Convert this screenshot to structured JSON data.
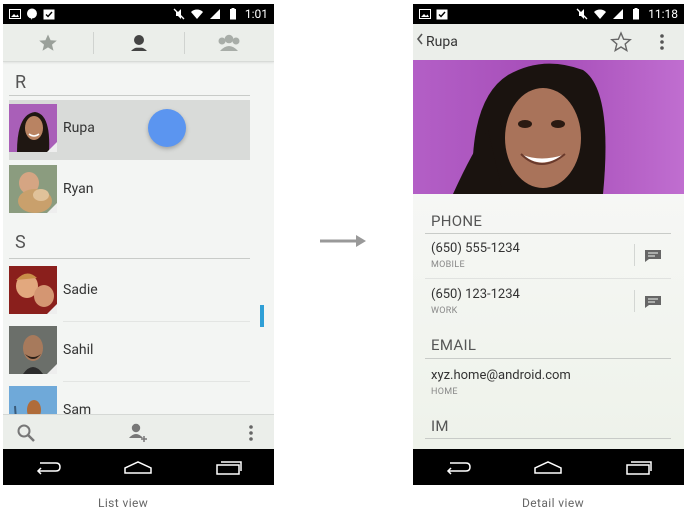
{
  "left_phone": {
    "status_time": "1:01",
    "tabs": [
      {
        "icon": "star-icon"
      },
      {
        "icon": "person-icon"
      },
      {
        "icon": "group-icon"
      }
    ],
    "sections": [
      {
        "letter": "R",
        "contacts": [
          {
            "name": "Rupa",
            "selected": true
          },
          {
            "name": "Ryan"
          }
        ]
      },
      {
        "letter": "S",
        "contacts": [
          {
            "name": "Sadie"
          },
          {
            "name": "Sahil"
          },
          {
            "name": "Sam"
          }
        ]
      }
    ],
    "bottom_actions": [
      "search-icon",
      "add-contact-icon",
      "overflow-menu-icon"
    ]
  },
  "right_phone": {
    "status_time": "11:18",
    "title": "Rupa",
    "sections": {
      "phone": {
        "label": "PHONE",
        "items": [
          {
            "value": "(650) 555-1234",
            "type": "MOBILE"
          },
          {
            "value": "(650) 123-1234",
            "type": "WORK"
          }
        ]
      },
      "email": {
        "label": "EMAIL",
        "items": [
          {
            "value": "xyz.home@android.com",
            "type": "HOME"
          }
        ]
      },
      "im": {
        "label": "IM"
      }
    }
  },
  "captions": {
    "left": "List view",
    "right": "Detail view"
  },
  "colors": {
    "accent_blue": "#2f9fd6",
    "touch_dot": "#5b95f0",
    "hero_bg": "#b35fc6"
  }
}
